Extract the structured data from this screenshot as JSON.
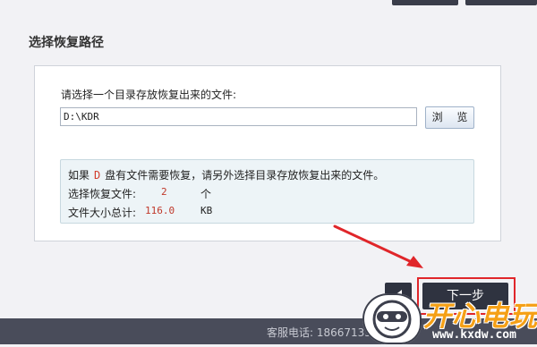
{
  "header": {
    "section_title": "选择恢复路径"
  },
  "panel": {
    "prompt": "请选择一个目录存放恢复出来的文件:",
    "path_value": "D:\\KDR",
    "browse_label": "浏 览"
  },
  "info": {
    "line_prefix": "如果",
    "drive_letter": "D",
    "line_suffix": "盘有文件需要恢复，请另外选择目录存放恢复出来的文件。",
    "count_label": "选择恢复文件:",
    "count_value": "2",
    "count_unit": "个",
    "size_label": "文件大小总计:",
    "size_value": "116.0",
    "size_unit": "KB"
  },
  "nav": {
    "next_label": "下一步"
  },
  "footer": {
    "hotline": "客服电话: 1866713360"
  },
  "watermark": {
    "title": "开心电玩",
    "url": "www.kxdw.com"
  },
  "colors": {
    "accent_red": "#e0262a",
    "dark_button": "#2f3340",
    "watermark_orange": "#f5a016"
  }
}
